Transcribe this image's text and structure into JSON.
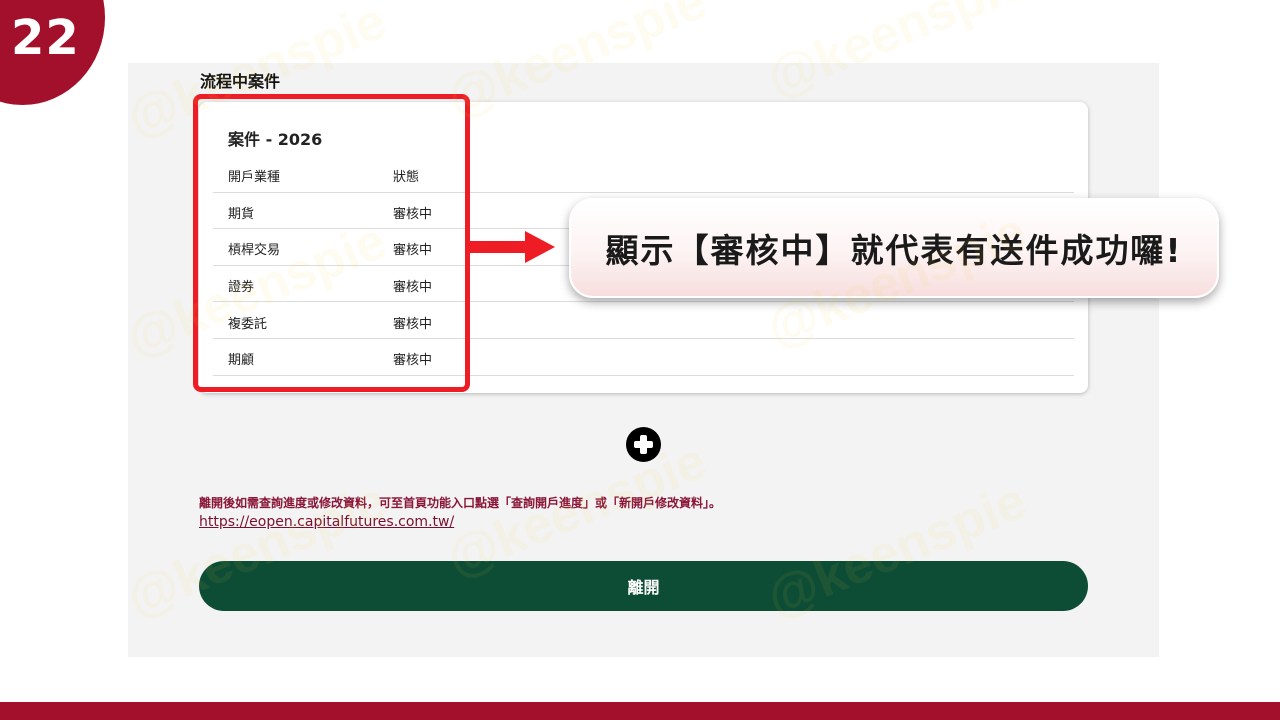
{
  "step": {
    "number": "22"
  },
  "section": {
    "title": "流程中案件"
  },
  "case_card": {
    "title": "案件 - 2026",
    "columns": {
      "type": "開戶業種",
      "status": "狀態"
    },
    "rows": [
      {
        "type": "期貨",
        "status": "審核中"
      },
      {
        "type": "槓桿交易",
        "status": "審核中"
      },
      {
        "type": "證券",
        "status": "審核中"
      },
      {
        "type": "複委託",
        "status": "審核中"
      },
      {
        "type": "期顧",
        "status": "審核中"
      }
    ]
  },
  "callout": {
    "text": "顯示【審核中】就代表有送件成功囉!"
  },
  "note": {
    "text": "離開後如需查詢進度或修改資料，可至首頁功能入口點選「查詢開戶進度」或「新開戶修改資料」。",
    "link": "https://eopen.capitalfutures.com.tw/"
  },
  "buttons": {
    "leave": "離開"
  },
  "watermark": {
    "text": "@keenspie"
  },
  "colors": {
    "brand_red": "#a3102b",
    "highlight_red": "#ee1c25",
    "button_green": "#0d4d35",
    "note_text": "#8a1538"
  }
}
